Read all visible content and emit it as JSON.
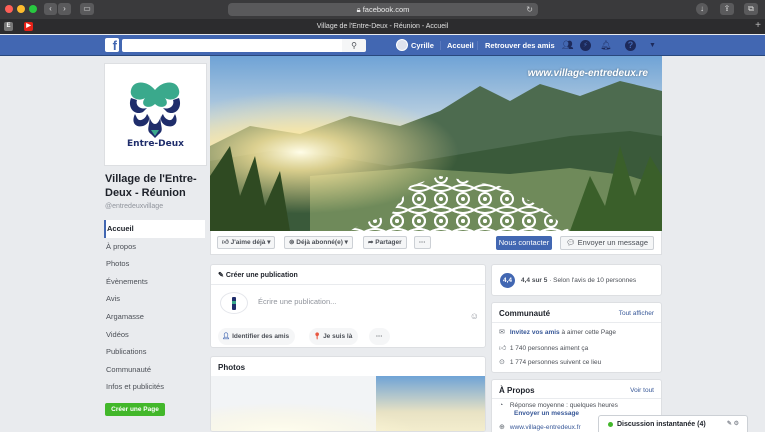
{
  "browser": {
    "url": "facebook.com",
    "tab_title": "Village de l'Entre-Deux - Réunion - Accueil"
  },
  "fb_header": {
    "user_name": "Cyrille",
    "home": "Accueil",
    "find_friends": "Retrouver des amis"
  },
  "page": {
    "logo_text": "Entre-Deux",
    "name": "Village de l'Entre-Deux - Réunion",
    "handle": "@entredeuxvillage",
    "cover_url": "www.village-entredeux.re"
  },
  "left_nav": [
    {
      "label": "Accueil"
    },
    {
      "label": "À propos"
    },
    {
      "label": "Photos"
    },
    {
      "label": "Évènements"
    },
    {
      "label": "Avis"
    },
    {
      "label": "Argamasse"
    },
    {
      "label": "Vidéos"
    },
    {
      "label": "Publications"
    },
    {
      "label": "Communauté"
    },
    {
      "label": "Infos et publicités"
    }
  ],
  "create_page": "Créer une Page",
  "actions": {
    "like": "J'aime déjà",
    "follow": "Déjà abonné(e)",
    "share": "Partager",
    "more": "···",
    "contact": "Nous contacter",
    "message": "Envoyer un message"
  },
  "composer": {
    "title": "Créer une publication",
    "placeholder": "Écrire une publication...",
    "tag_friends": "Identifier des amis",
    "checkin": "Je suis là",
    "more": "···"
  },
  "photos": {
    "title": "Photos"
  },
  "rating": {
    "score": "4,4",
    "summary": "4,4 sur 5",
    "detail": " · Selon l'avis de 10 personnes"
  },
  "community": {
    "title": "Communauté",
    "see_all": "Tout afficher",
    "invite_link": "Invitez vos amis",
    "invite_rest": " à aimer cette Page",
    "likes": "1 740 personnes aiment ça",
    "followers": "1 774 personnes suivent ce lieu"
  },
  "about": {
    "title": "À Propos",
    "see_all": "Voir tout",
    "response": "Réponse moyenne : quelques heures",
    "send_message": "Envoyer un message",
    "website": "www.village-entredeux.fr"
  },
  "chat": {
    "label": "Discussion instantanée (4)"
  }
}
